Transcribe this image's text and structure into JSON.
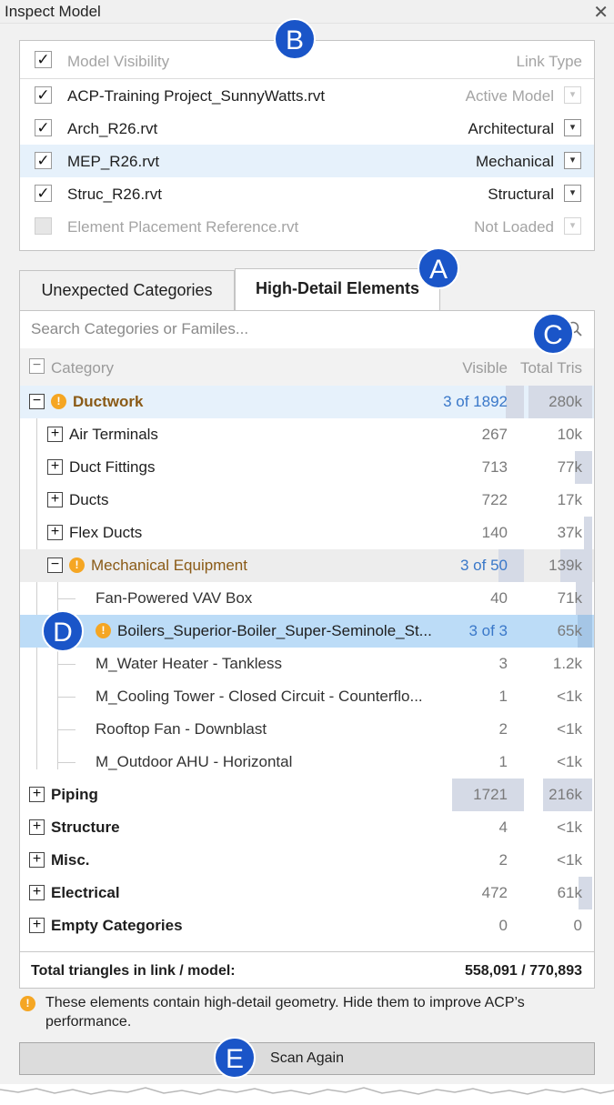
{
  "window": {
    "title": "Inspect Model"
  },
  "model_visibility": {
    "header": "Model Visibility",
    "link_type_header": "Link Type",
    "rows": [
      {
        "name": "ACP-Training Project_SunnyWatts.rvt",
        "type": "Active Model",
        "checked": true,
        "disabled": false,
        "type_disabled": true
      },
      {
        "name": "Arch_R26.rvt",
        "type": "Architectural",
        "checked": true,
        "disabled": false,
        "type_disabled": false
      },
      {
        "name": "MEP_R26.rvt",
        "type": "Mechanical",
        "checked": true,
        "disabled": false,
        "type_disabled": false,
        "selected": true
      },
      {
        "name": "Struc_R26.rvt",
        "type": "Structural",
        "checked": true,
        "disabled": false,
        "type_disabled": false
      },
      {
        "name": "Element Placement Reference.rvt",
        "type": "Not Loaded",
        "checked": false,
        "disabled": true,
        "type_disabled": true
      }
    ]
  },
  "tabs": [
    {
      "label": "Unexpected Categories",
      "active": false
    },
    {
      "label": "High-Detail Elements",
      "active": true
    }
  ],
  "search": {
    "placeholder": "Search Categories or Familes..."
  },
  "columns": {
    "category": "Category",
    "visible": "Visible",
    "total_tris": "Total Tris"
  },
  "rows": [
    {
      "label": "Ductwork",
      "visible": "3 of 1892",
      "tris": "280k",
      "level": 0,
      "expander": "minus",
      "warn": true,
      "bold": true,
      "style": "warn-bold"
    },
    {
      "label": "Air Terminals",
      "visible": "267",
      "tris": "10k",
      "level": 1,
      "expander": "plus"
    },
    {
      "label": "Duct Fittings",
      "visible": "713",
      "tris": "77k",
      "level": 1,
      "expander": "plus"
    },
    {
      "label": "Ducts",
      "visible": "722",
      "tris": "17k",
      "level": 1,
      "expander": "plus"
    },
    {
      "label": "Flex Ducts",
      "visible": "140",
      "tris": "37k",
      "level": 1,
      "expander": "plus"
    },
    {
      "label": "Mechanical Equipment",
      "visible": "3 of 50",
      "tris": "139k",
      "level": 1,
      "expander": "minus",
      "warn": true,
      "style": "warn"
    },
    {
      "label": "Fan-Powered VAV Box",
      "visible": "40",
      "tris": "71k",
      "level": 2
    },
    {
      "label": "Boilers_Superior-Boiler_Super-Seminole_St...",
      "visible": "3 of 3",
      "tris": "65k",
      "level": 2,
      "warn": true,
      "style": "selected"
    },
    {
      "label": "M_Water Heater - Tankless",
      "visible": "3",
      "tris": "1.2k",
      "level": 2
    },
    {
      "label": "M_Cooling Tower - Closed Circuit - Counterflo...",
      "visible": "1",
      "tris": "<1k",
      "level": 2
    },
    {
      "label": "Rooftop Fan - Downblast",
      "visible": "2",
      "tris": "<1k",
      "level": 2
    },
    {
      "label": "M_Outdoor AHU - Horizontal",
      "visible": "1",
      "tris": "<1k",
      "level": 2
    },
    {
      "label": "Piping",
      "visible": "1721",
      "tris": "216k",
      "level": 0,
      "expander": "plus",
      "bold": true
    },
    {
      "label": "Structure",
      "visible": "4",
      "tris": "<1k",
      "level": 0,
      "expander": "plus",
      "bold": true
    },
    {
      "label": "Misc.",
      "visible": "2",
      "tris": "<1k",
      "level": 0,
      "expander": "plus",
      "bold": true
    },
    {
      "label": "Electrical",
      "visible": "472",
      "tris": "61k",
      "level": 0,
      "expander": "plus",
      "bold": true
    },
    {
      "label": "Empty Categories",
      "visible": "0",
      "tris": "0",
      "level": 0,
      "expander": "plus",
      "bold": true
    }
  ],
  "totals": {
    "label": "Total triangles in link / model:",
    "value": "558,091 / 770,893"
  },
  "note": "These elements contain high-detail geometry. Hide them to improve ACP’s performance.",
  "scan_button": "Scan Again",
  "callouts": {
    "a": "A",
    "b": "B",
    "c": "C",
    "d": "D",
    "e": "E"
  },
  "colors": {
    "accent_blue": "#1a55c8",
    "link_blue": "#3a78c9",
    "warn_orange": "#f5a623",
    "warn_text": "#8a5a16",
    "selected_row": "#bcdcf7",
    "hover_row": "#e6f1fb",
    "bar": "#d5dae6"
  }
}
